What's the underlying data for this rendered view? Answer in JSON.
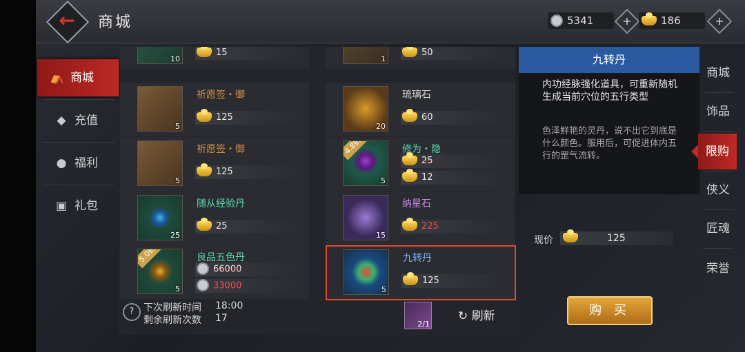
{
  "header": {
    "title": "商城",
    "silver": "5341",
    "gold": "186"
  },
  "nav": [
    {
      "label": "商城",
      "icon": "shop-icon"
    },
    {
      "label": "充值",
      "icon": "ingot-icon"
    },
    {
      "label": "福利",
      "icon": "pig-icon"
    },
    {
      "label": "礼包",
      "icon": "gift-icon"
    }
  ],
  "items": [
    {
      "name": "",
      "count": "10",
      "price": "15"
    },
    {
      "name": "",
      "count": "1",
      "price": "50"
    },
    {
      "name": "祈愿签・御",
      "count": "5",
      "price": "125"
    },
    {
      "name": "琉璃石",
      "count": "20",
      "price": "60"
    },
    {
      "name": "祈愿签・御",
      "count": "5",
      "price": "125"
    },
    {
      "name": "修为・隐",
      "count": "5",
      "badge": "4.8折",
      "old_price": "25",
      "price": "12"
    },
    {
      "name": "随从经验丹",
      "count": "25",
      "price": "25"
    },
    {
      "name": "纳星石",
      "count": "15",
      "price": "225"
    },
    {
      "name": "良品五色丹",
      "count": "5",
      "badge": "5.0折",
      "old_price": "66000",
      "price": "33000"
    },
    {
      "name": "九转丹",
      "count": "5",
      "price": "125"
    }
  ],
  "bottom": {
    "help": "?",
    "next_label": "下次刷新时间",
    "next_value": "18:00",
    "remain_label": "剩余刷新次数",
    "remain_value": "17",
    "ticket_count": "2/1",
    "refresh_label": "刷新"
  },
  "detail": {
    "title": "九转丹",
    "summary": "内功经脉强化道具，可重新随机生成当前穴位的五行类型",
    "description": "色泽鲜艳的灵丹，说不出它到底是什么颜色。服用后，可促进体内五行的罡气流转。",
    "price_label": "现价",
    "price": "125",
    "buy_label": "购 买"
  },
  "tabs": [
    "商城",
    "饰品",
    "限购",
    "侠义",
    "匠魂",
    "荣誉"
  ],
  "colors": {
    "accent": "#c02a24",
    "selected_border": "#e04a30",
    "detail_header": "#2a5aa0",
    "gold": "#e2a63a"
  }
}
